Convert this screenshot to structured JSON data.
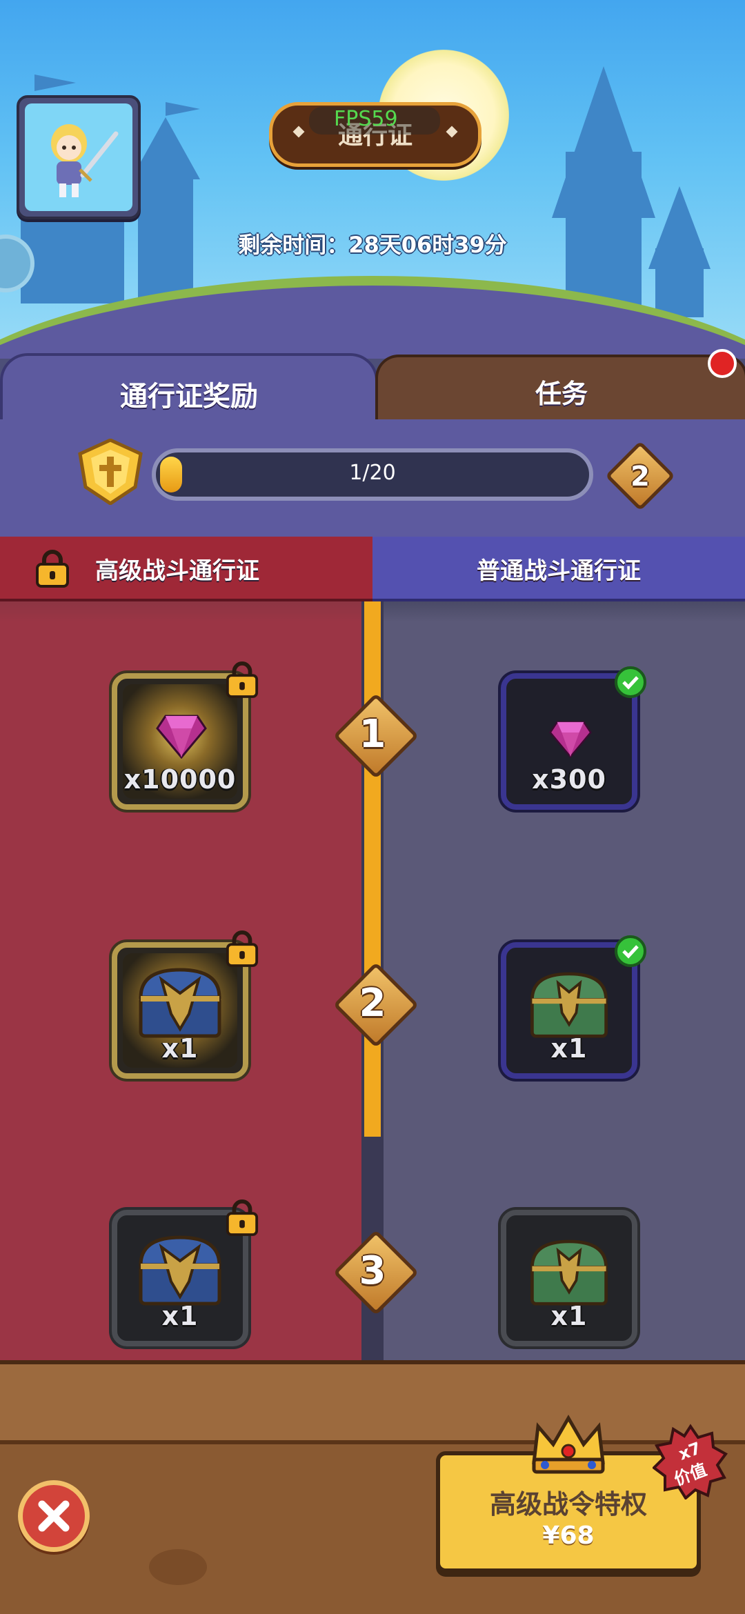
{
  "header": {
    "title": "通行证",
    "fps_label": "FPS59",
    "remaining_time": "剩余时间：28天06时39分"
  },
  "tabs": [
    {
      "label": "通行证奖励",
      "active": true
    },
    {
      "label": "任务",
      "active": false,
      "has_notification": true
    }
  ],
  "progress": {
    "text": "1/20",
    "fraction": 0.05,
    "next_level": "2"
  },
  "columns": {
    "premium_label": "高级战斗通行证",
    "normal_label": "普通战斗通行证"
  },
  "levels": [
    {
      "level": "1",
      "premium": {
        "item": "gem-icon",
        "qty": "x10000",
        "locked": true
      },
      "normal": {
        "item": "gem-icon",
        "qty": "x300",
        "claimed": true
      }
    },
    {
      "level": "2",
      "premium": {
        "item": "blue-chest-icon",
        "qty": "x1",
        "locked": true
      },
      "normal": {
        "item": "green-chest-icon",
        "qty": "x1",
        "claimed": true
      }
    },
    {
      "level": "3",
      "premium": {
        "item": "blue-chest-icon",
        "qty": "x1",
        "locked": true
      },
      "normal": {
        "item": "green-chest-icon",
        "qty": "x1",
        "claimed": false
      }
    }
  ],
  "purchase": {
    "title": "高级战令特权",
    "price": "¥68",
    "badge_line1": "x7",
    "badge_line2": "价值"
  },
  "colors": {
    "premium_bg": "#9b3545",
    "normal_bg": "#5b5978",
    "accent_gold": "#f1a91f",
    "buy_button": "#f5c744"
  }
}
